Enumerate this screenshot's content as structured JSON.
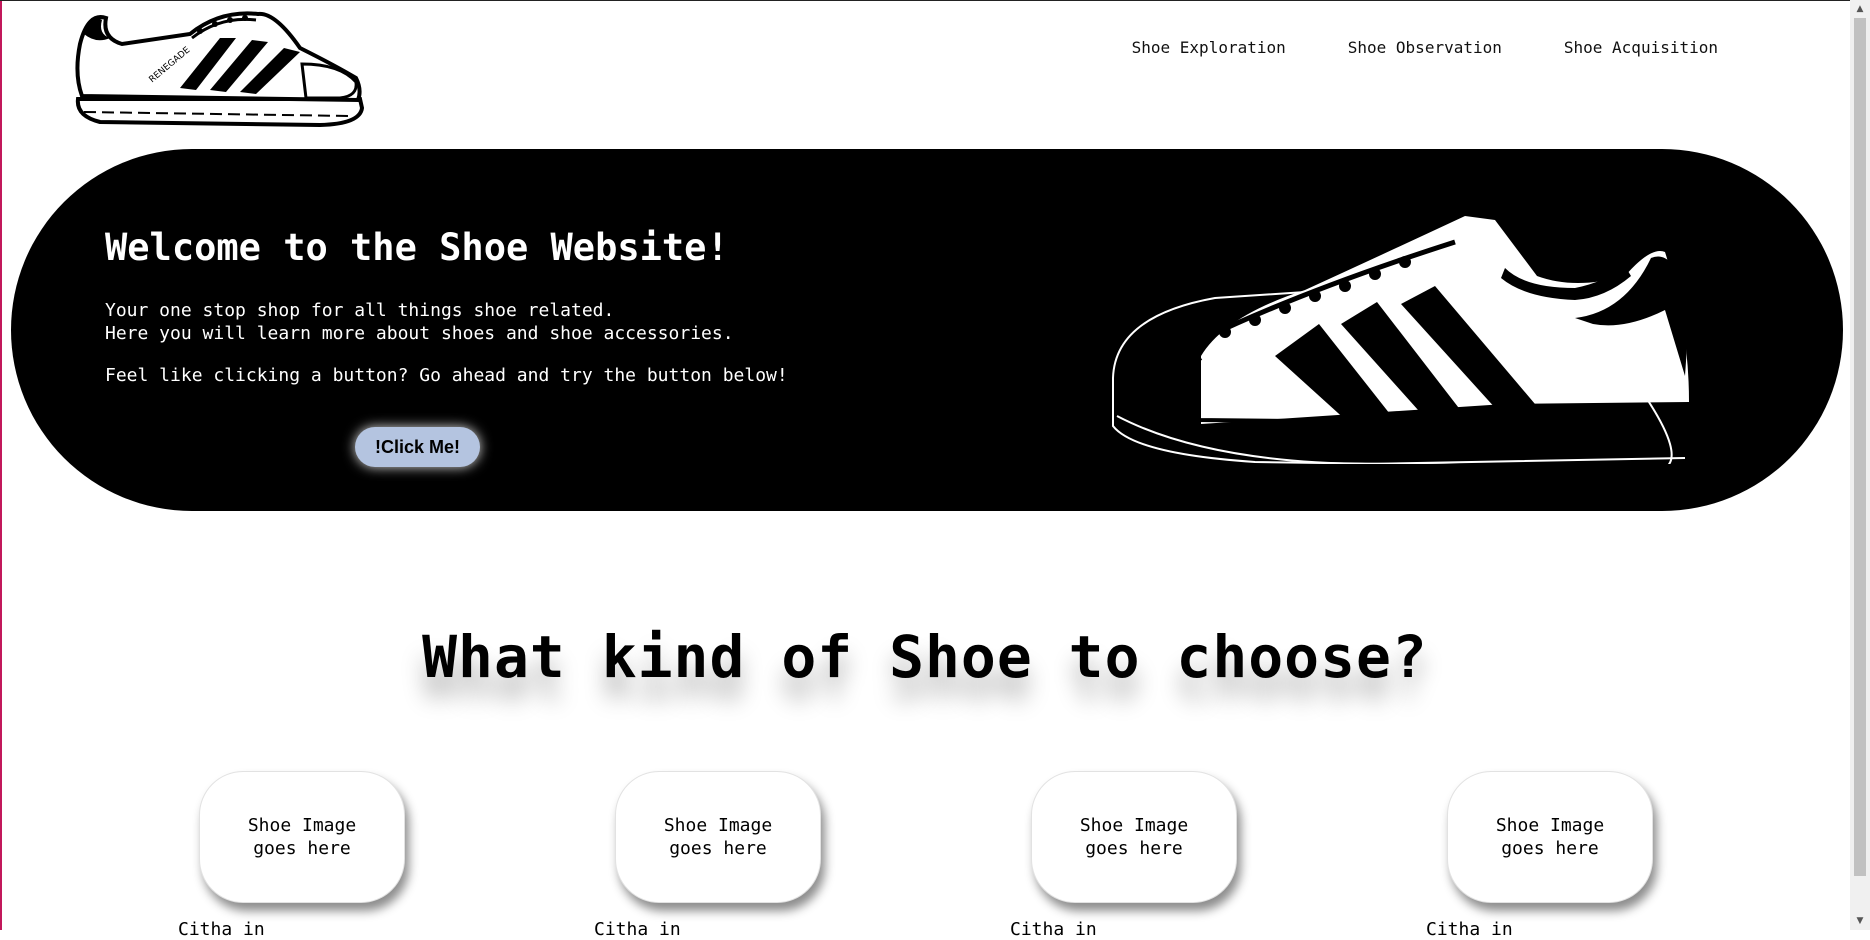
{
  "nav": {
    "items": [
      "Shoe Exploration",
      "Shoe Observation",
      "Shoe Acquisition"
    ]
  },
  "logo": {
    "brand_text": "RENEGADE"
  },
  "hero": {
    "title": "Welcome to the Shoe Website!",
    "line1": "Your one stop shop for all things shoe related.",
    "line2": "Here you will learn more about shoes and shoe accessories.",
    "line3": "Feel like clicking a button? Go ahead and try the button below!",
    "button_label": "!Click Me!",
    "button_color": "#b4c4e0"
  },
  "section": {
    "title": "What kind of Shoe to choose?"
  },
  "cards": [
    {
      "image_text": "Shoe Image goes here",
      "caption": "Citha in"
    },
    {
      "image_text": "Shoe Image goes here",
      "caption": "Citha in"
    },
    {
      "image_text": "Shoe Image goes here",
      "caption": "Citha in"
    },
    {
      "image_text": "Shoe Image goes here",
      "caption": "Citha in"
    }
  ],
  "scrollbar": {
    "up_icon": "scroll-up-arrow-icon",
    "down_icon": "scroll-down-arrow-icon"
  }
}
